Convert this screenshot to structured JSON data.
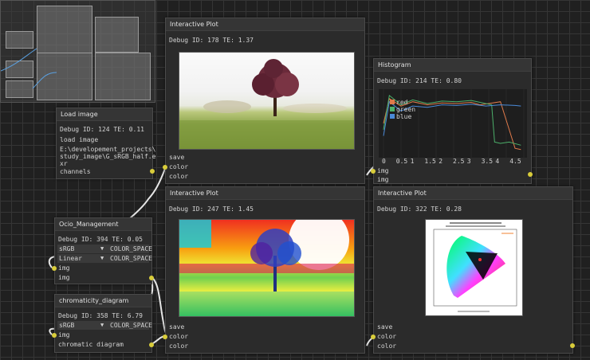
{
  "nodes": {
    "load_image": {
      "title": "Load image",
      "debug": "Debug ID: 124 TE: 0.11",
      "label": "load image",
      "path_line1": "E:\\developement_projects\\",
      "path_line2": "study_image\\G_sRGB_half.e",
      "path_line3": "xr",
      "output": "channels"
    },
    "plot_top": {
      "title": "Interactive Plot",
      "debug": "Debug ID: 178 TE: 1.37",
      "save": "save",
      "in1": "color",
      "in2": "color"
    },
    "histogram": {
      "title": "Histogram",
      "debug": "Debug ID: 214 TE: 0.80",
      "legend": [
        "red",
        "green",
        "blue"
      ],
      "in1": "img",
      "in2": "img"
    },
    "ocio": {
      "title": "Ocio_Management",
      "debug": "Debug ID: 394 TE: 0.05",
      "combo1_value": "sRGB",
      "combo1_label": "COLOR_SPACE",
      "combo2_value": "Linear",
      "combo2_label": "COLOR_SPACE",
      "in": "img",
      "out": "img"
    },
    "plot_mid": {
      "title": "Interactive Plot",
      "debug": "Debug ID: 247 TE: 1.45",
      "save": "save",
      "in1": "color",
      "in2": "color"
    },
    "chroma": {
      "title": "chromaticity_diagram",
      "debug": "Debug ID: 358 TE: 6.79",
      "combo_value": "sRGB",
      "combo_label": "COLOR_SPACE",
      "in": "img",
      "out": "chromatic diagram"
    },
    "plot_right": {
      "title": "Interactive Plot",
      "debug": "Debug ID: 322 TE: 0.28",
      "save": "save",
      "in1": "color",
      "in2": "color"
    }
  },
  "chart_data": {
    "type": "line",
    "x_ticks": [
      "0",
      "0.5",
      "1",
      "1.5",
      "2",
      "2.5",
      "3",
      "3.5",
      "4",
      "4.5"
    ],
    "xlim": [
      0,
      4.8
    ],
    "series": [
      {
        "name": "red",
        "color": "#e07a4a",
        "x": [
          0,
          0.2,
          0.6,
          1,
          1.5,
          2,
          2.5,
          3,
          3.3,
          3.6,
          4,
          4.2,
          4.5,
          4.7
        ],
        "y": [
          0.5,
          0.9,
          0.78,
          0.85,
          0.8,
          0.83,
          0.82,
          0.84,
          0.8,
          0.82,
          0.85,
          0.55,
          0.1,
          0.08
        ]
      },
      {
        "name": "green",
        "color": "#4cb06a",
        "x": [
          0,
          0.2,
          0.6,
          1,
          1.5,
          2,
          2.5,
          3,
          3.4,
          3.7,
          3.8,
          4,
          4.3,
          4.7
        ],
        "y": [
          0.4,
          0.95,
          0.8,
          0.88,
          0.82,
          0.86,
          0.85,
          0.87,
          0.83,
          0.8,
          0.2,
          0.18,
          0.2,
          0.15
        ]
      },
      {
        "name": "blue",
        "color": "#4a8ad8",
        "x": [
          0,
          0.2,
          0.6,
          1,
          1.5,
          2,
          2.5,
          3,
          3.5,
          4,
          4.5,
          4.7
        ],
        "y": [
          0.3,
          0.85,
          0.7,
          0.78,
          0.76,
          0.8,
          0.79,
          0.81,
          0.78,
          0.8,
          0.79,
          0.78
        ]
      }
    ]
  },
  "colors": {
    "pin": "#d8cc3a",
    "node_bg": "#2b2b2b",
    "title_bg": "#353535",
    "link": "#e6e6e6"
  }
}
